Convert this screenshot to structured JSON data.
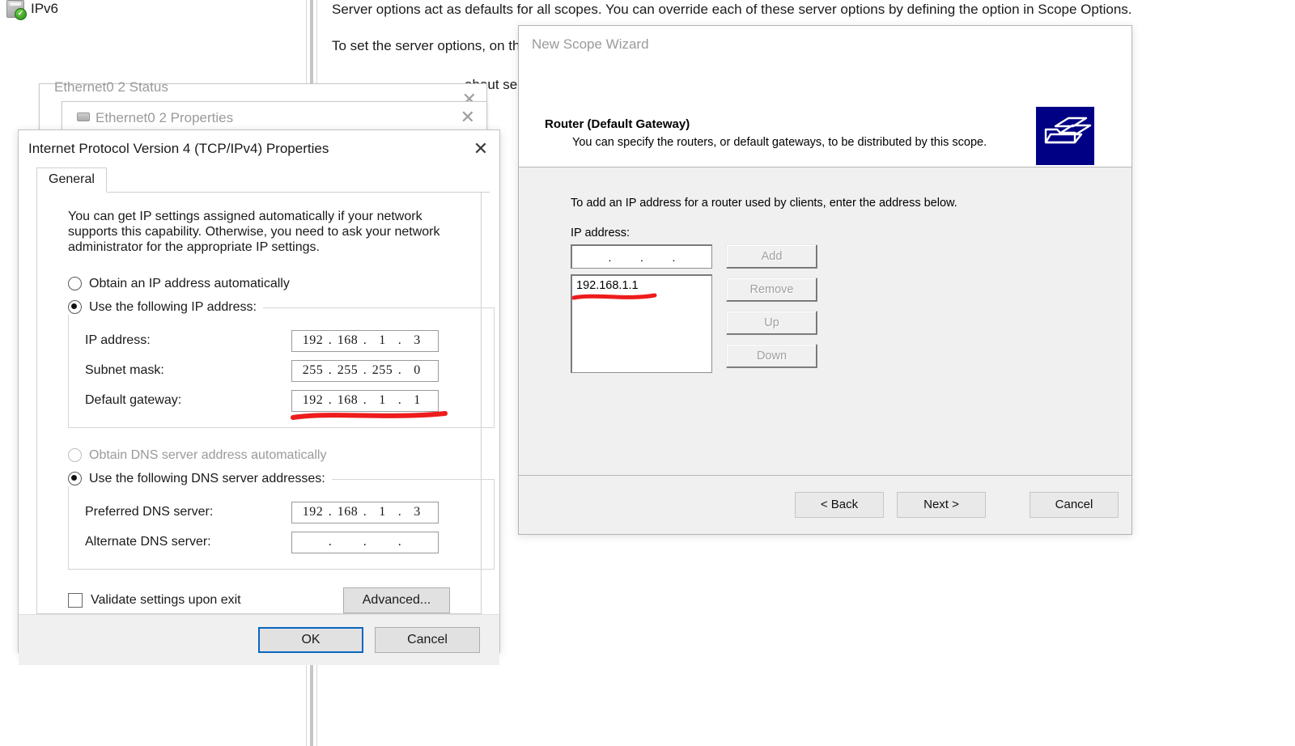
{
  "background": {
    "tree_item": {
      "label": "IPv6",
      "icon": "ipv6-status-icon"
    },
    "line1": "Server options act as defaults for all scopes.  You can override each of these server options by defining the option in Scope Options.",
    "line2": "To set the server options, on th",
    "line3": "about se"
  },
  "shells": {
    "status_window": {
      "title": "Ethernet0 2 Status",
      "close": "✕"
    },
    "properties_window": {
      "title": "Ethernet0 2 Properties",
      "close": "✕"
    }
  },
  "ipv4_dialog": {
    "title": "Internet Protocol Version 4 (TCP/IPv4) Properties",
    "close": "✕",
    "tabs": [
      {
        "label": "General",
        "selected": true
      }
    ],
    "help_text": "You can get IP settings assigned automatically if your network supports this capability. Otherwise, you need to ask your network administrator for the appropriate IP settings.",
    "ip_mode": {
      "auto_label": "Obtain an IP address automatically",
      "auto_selected": false,
      "manual_label": "Use the following IP address:",
      "manual_selected": true
    },
    "ip_fields": [
      {
        "label": "IP address:",
        "octets": [
          "192",
          "168",
          "1",
          "3"
        ]
      },
      {
        "label": "Subnet mask:",
        "octets": [
          "255",
          "255",
          "255",
          "0"
        ]
      },
      {
        "label": "Default gateway:",
        "octets": [
          "192",
          "168",
          "1",
          "1"
        ],
        "annotated": true
      }
    ],
    "dns_mode": {
      "auto_label": "Obtain DNS server address automatically",
      "auto_selected": false,
      "auto_disabled": true,
      "manual_label": "Use the following DNS server addresses:",
      "manual_selected": true
    },
    "dns_fields": [
      {
        "label": "Preferred DNS server:",
        "octets": [
          "192",
          "168",
          "1",
          "3"
        ]
      },
      {
        "label": "Alternate DNS server:",
        "octets": [
          "",
          "",
          "",
          ""
        ]
      }
    ],
    "validate": {
      "label": "Validate settings upon exit",
      "checked": false
    },
    "advanced_label": "Advanced...",
    "ok_label": "OK",
    "cancel_label": "Cancel"
  },
  "scope_wizard": {
    "window_title": "New Scope Wizard",
    "heading": "Router (Default Gateway)",
    "subheading": "You can specify the routers, or default gateways, to be distributed by this scope.",
    "instruction": "To add an IP address for a router used by clients, enter the address below.",
    "ip_label": "IP address:",
    "ip_input_octets": [
      "",
      "",
      "",
      ""
    ],
    "router_list": [
      "192.168.1.1"
    ],
    "side_buttons": [
      {
        "label": "Add",
        "disabled": true
      },
      {
        "label": "Remove",
        "disabled": true
      },
      {
        "label": "Up",
        "disabled": true
      },
      {
        "label": "Down",
        "disabled": true
      }
    ],
    "footer_buttons": [
      {
        "label": "< Back"
      },
      {
        "label": "Next >"
      },
      {
        "label": "Cancel"
      }
    ]
  },
  "annotations": {
    "color": "#ee1c1c",
    "gateway_underline": "red hand-drawn underline under Default gateway field",
    "router_list_underline": "red hand-drawn underline under 192.168.1.1 list entry"
  }
}
